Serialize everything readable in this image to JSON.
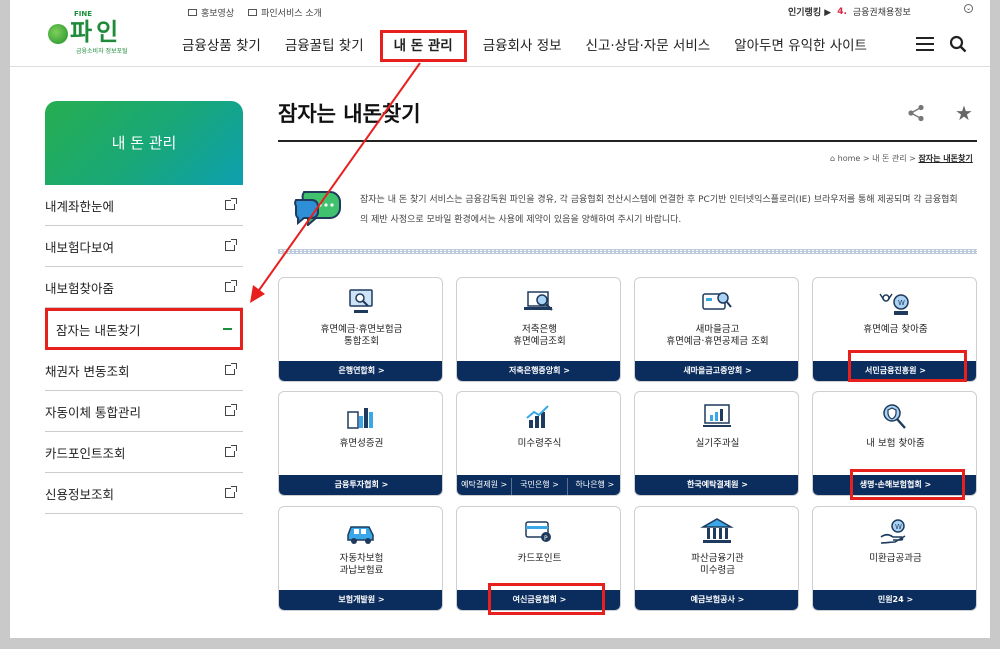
{
  "header": {
    "logo_fine": "FINE",
    "logo_name": "파인",
    "logo_sub": "금융소비자 정보포털",
    "top_links": [
      "홍보영상",
      "파인서비스 소개"
    ],
    "ranking_label": "인기랭킹 ▶",
    "ranking_num": "4.",
    "ranking_text": "금융권채용정보",
    "nav": [
      "금융상품 찾기",
      "금융꿀팁 찾기",
      "내 돈 관리",
      "금융회사 정보",
      "신고·상담·자문 서비스",
      "알아두면 유익한 사이트"
    ]
  },
  "sidebar": {
    "title": "내 돈 관리",
    "items": [
      "내계좌한눈에",
      "내보험다보여",
      "내보험찾아줌",
      "잠자는 내돈찾기",
      "채권자 변동조회",
      "자동이체 통합관리",
      "카드포인트조회",
      "신용정보조회"
    ]
  },
  "page": {
    "title": "잠자는 내돈찾기",
    "breadcrumb": [
      "home",
      "내 돈 관리",
      "잠자는 내돈찾기"
    ],
    "intro": "잠자는 내 돈 찾기 서비스는 금융감독원 파인을 경유, 각 금융협회 전산시스템에 연결한 후 PC기반 인터넷익스플로러(IE) 브라우저를 통해 제공되며 각 금융협회의 제반 사정으로 모바일 환경에서는 사용에 제약이 있음을 양해하여 주시기 바랍니다."
  },
  "cards": [
    {
      "icon": "monitor-search-icon",
      "label": "휴면예금·휴면보험금\n통합조회",
      "foot": [
        "은행연합회 >"
      ]
    },
    {
      "icon": "laptop-search-icon",
      "label": "저축은행\n휴면예금조회",
      "foot": [
        "저축은행중앙회 >"
      ]
    },
    {
      "icon": "card-search-icon",
      "label": "새마을금고\n휴면예금·휴면공제금 조회",
      "foot": [
        "새마을금고중앙회 >"
      ]
    },
    {
      "icon": "people-coin-icon",
      "label": "휴면예금 찾아줌",
      "foot": [
        "서민금융진흥원 >"
      ]
    },
    {
      "icon": "certificate-chart-icon",
      "label": "휴면성증권",
      "foot": [
        "금융투자협회 >"
      ]
    },
    {
      "icon": "stock-chart-icon",
      "label": "미수령주식",
      "foot": [
        "예탁결제원 >",
        "국민은행 >",
        "하나은행 >"
      ]
    },
    {
      "icon": "monitor-chart-icon",
      "label": "실기주과실",
      "foot": [
        "한국예탁결제원 >"
      ]
    },
    {
      "icon": "shield-search-icon",
      "label": "내 보험 찾아줌",
      "foot": [
        "생명·손해보험협회 >"
      ]
    },
    {
      "icon": "car-icon",
      "label": "자동차보험\n과납보험료",
      "foot": [
        "보험개발원 >"
      ]
    },
    {
      "icon": "credit-card-icon",
      "label": "카드포인트",
      "foot": [
        "여신금융협회 >"
      ]
    },
    {
      "icon": "bank-building-icon",
      "label": "파산금융기관\n미수령금",
      "foot": [
        "예금보험공사 >"
      ]
    },
    {
      "icon": "hand-coin-icon",
      "label": "미환급공과금",
      "foot": [
        "민원24 >"
      ]
    }
  ],
  "colors": {
    "accent_red": "#e8201d",
    "navy": "#0b2d5e",
    "green": "#1e8a3a"
  }
}
